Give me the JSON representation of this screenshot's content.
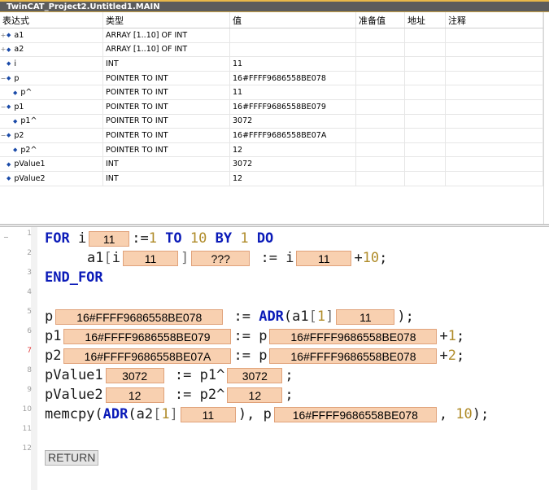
{
  "window": {
    "title": "TwinCAT_Project2.Untitled1.MAIN"
  },
  "watch": {
    "columns": [
      "表达式",
      "类型",
      "值",
      "准备值",
      "地址",
      "注释"
    ],
    "rows": [
      {
        "toggle": "+",
        "expr": "a1",
        "type": "ARRAY [1..10] OF INT",
        "value": ""
      },
      {
        "toggle": "+",
        "expr": "a2",
        "type": "ARRAY [1..10] OF INT",
        "value": ""
      },
      {
        "toggle": "",
        "expr": "i",
        "type": "INT",
        "value": "11"
      },
      {
        "toggle": "−",
        "expr": "p",
        "type": "POINTER TO INT",
        "value": "16#FFFF9686558BE078"
      },
      {
        "toggle": "",
        "expr": "p^",
        "type": "POINTER TO INT",
        "value": "11"
      },
      {
        "toggle": "−",
        "expr": "p1",
        "type": "POINTER TO INT",
        "value": "16#FFFF9686558BE079"
      },
      {
        "toggle": "",
        "expr": "p1^",
        "type": "POINTER TO INT",
        "value": "3072"
      },
      {
        "toggle": "−",
        "expr": "p2",
        "type": "POINTER TO INT",
        "value": "16#FFFF9686558BE07A"
      },
      {
        "toggle": "",
        "expr": "p2^",
        "type": "POINTER TO INT",
        "value": "12"
      },
      {
        "toggle": "",
        "expr": "pValue1",
        "type": "INT",
        "value": "3072"
      },
      {
        "toggle": "",
        "expr": "pValue2",
        "type": "INT",
        "value": "12"
      }
    ]
  },
  "editor": {
    "fold_icon": "−",
    "line_numbers": [
      "1",
      "2",
      "3",
      "4",
      "5",
      "6",
      "7",
      "8",
      "9",
      "10",
      "11",
      "12"
    ],
    "code": {
      "l1": {
        "kw_for": "FOR",
        "var": " i",
        "val_i": "11",
        "assign": ":=",
        "start": "1",
        "kw_to": " TO",
        "end": " 10",
        "kw_by": " BY",
        "step": " 1",
        "kw_do": " DO"
      },
      "l2": {
        "pre": "a1",
        "br_open": "[",
        "idx": "i",
        "val_i": "11",
        "br_close": "]",
        "val_elem": "???",
        "assign": " := ",
        "rhs_var": "i",
        "val_rhs": "11",
        "plus": "+",
        "ten": "10",
        "semi": ";"
      },
      "l3": {
        "kw_end": "END_FOR"
      },
      "l5": {
        "lhs": "p",
        "val_p": "16#FFFF9686558BE078",
        "assign": " := ",
        "fn": "ADR",
        "args_open": "(a1",
        "idx_open": "[",
        "idx": "1",
        "idx_close": "]",
        "val_a1": "11",
        "close": ");"
      },
      "l6": {
        "lhs": "p1",
        "val_p1": "16#FFFF9686558BE079",
        "assign": ":= ",
        "rhs": "p",
        "val_p": "16#FFFF9686558BE078",
        "plus": "+",
        "one": "1",
        "semi": ";"
      },
      "l7": {
        "lhs": "p2",
        "val_p2": "16#FFFF9686558BE07A",
        "assign": ":= ",
        "rhs": "p",
        "val_p": "16#FFFF9686558BE078",
        "plus": "+",
        "two": "2",
        "semi": ";"
      },
      "l8": {
        "lhs": "pValue1",
        "val_pv1": "3072",
        "assign": " := ",
        "rhs": "p1^",
        "val_rhs": "3072",
        "semi": ";"
      },
      "l9": {
        "lhs": "pValue2",
        "val_pv2": "12",
        "assign": " := ",
        "rhs": "p2^",
        "val_rhs": "12",
        "semi": ";"
      },
      "l10": {
        "fn": "memcpy",
        "open": "(",
        "adr": "ADR",
        "arg1": "(a2",
        "idx_open": "[",
        "idx": "1",
        "idx_close": "]",
        "val_a2": "11",
        "sep": "), ",
        "arg2": "p",
        "val_p": "16#FFFF9686558BE078",
        "comma": ", ",
        "size": "10",
        "close": ");"
      },
      "l12": {
        "ret": "RETURN"
      }
    }
  }
}
